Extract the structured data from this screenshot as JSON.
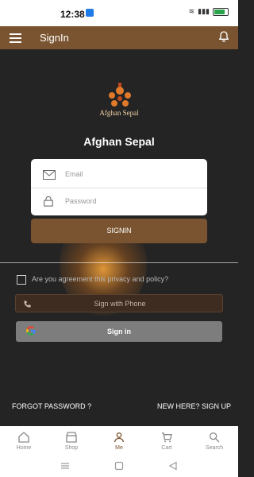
{
  "status_bar": {
    "time": "12:38"
  },
  "appbar": {
    "title": "SignIn"
  },
  "brand": {
    "logo_text": "Afghan Sepal",
    "name": "Afghan Sepal"
  },
  "login_form": {
    "email_label": "Email",
    "password_label": "Password",
    "submit_label": "SIGNIN"
  },
  "agreement": {
    "label": "Are you agreement this privacy and policy?"
  },
  "alt_signin": {
    "phone_label": "Sign with Phone",
    "google_label": "Sign in"
  },
  "links": {
    "forgot_password": "FORGOT PASSWORD ?",
    "signup": "NEW HERE? SIGN UP"
  },
  "tabs": [
    {
      "label": "Home",
      "icon": "home-icon"
    },
    {
      "label": "Shop",
      "icon": "shop-icon"
    },
    {
      "label": "Me",
      "icon": "user-icon",
      "active": true
    },
    {
      "label": "Cart",
      "icon": "cart-icon"
    },
    {
      "label": "Search",
      "icon": "search-icon"
    }
  ],
  "colors": {
    "accent": "#7a5430",
    "background": "#242424"
  }
}
